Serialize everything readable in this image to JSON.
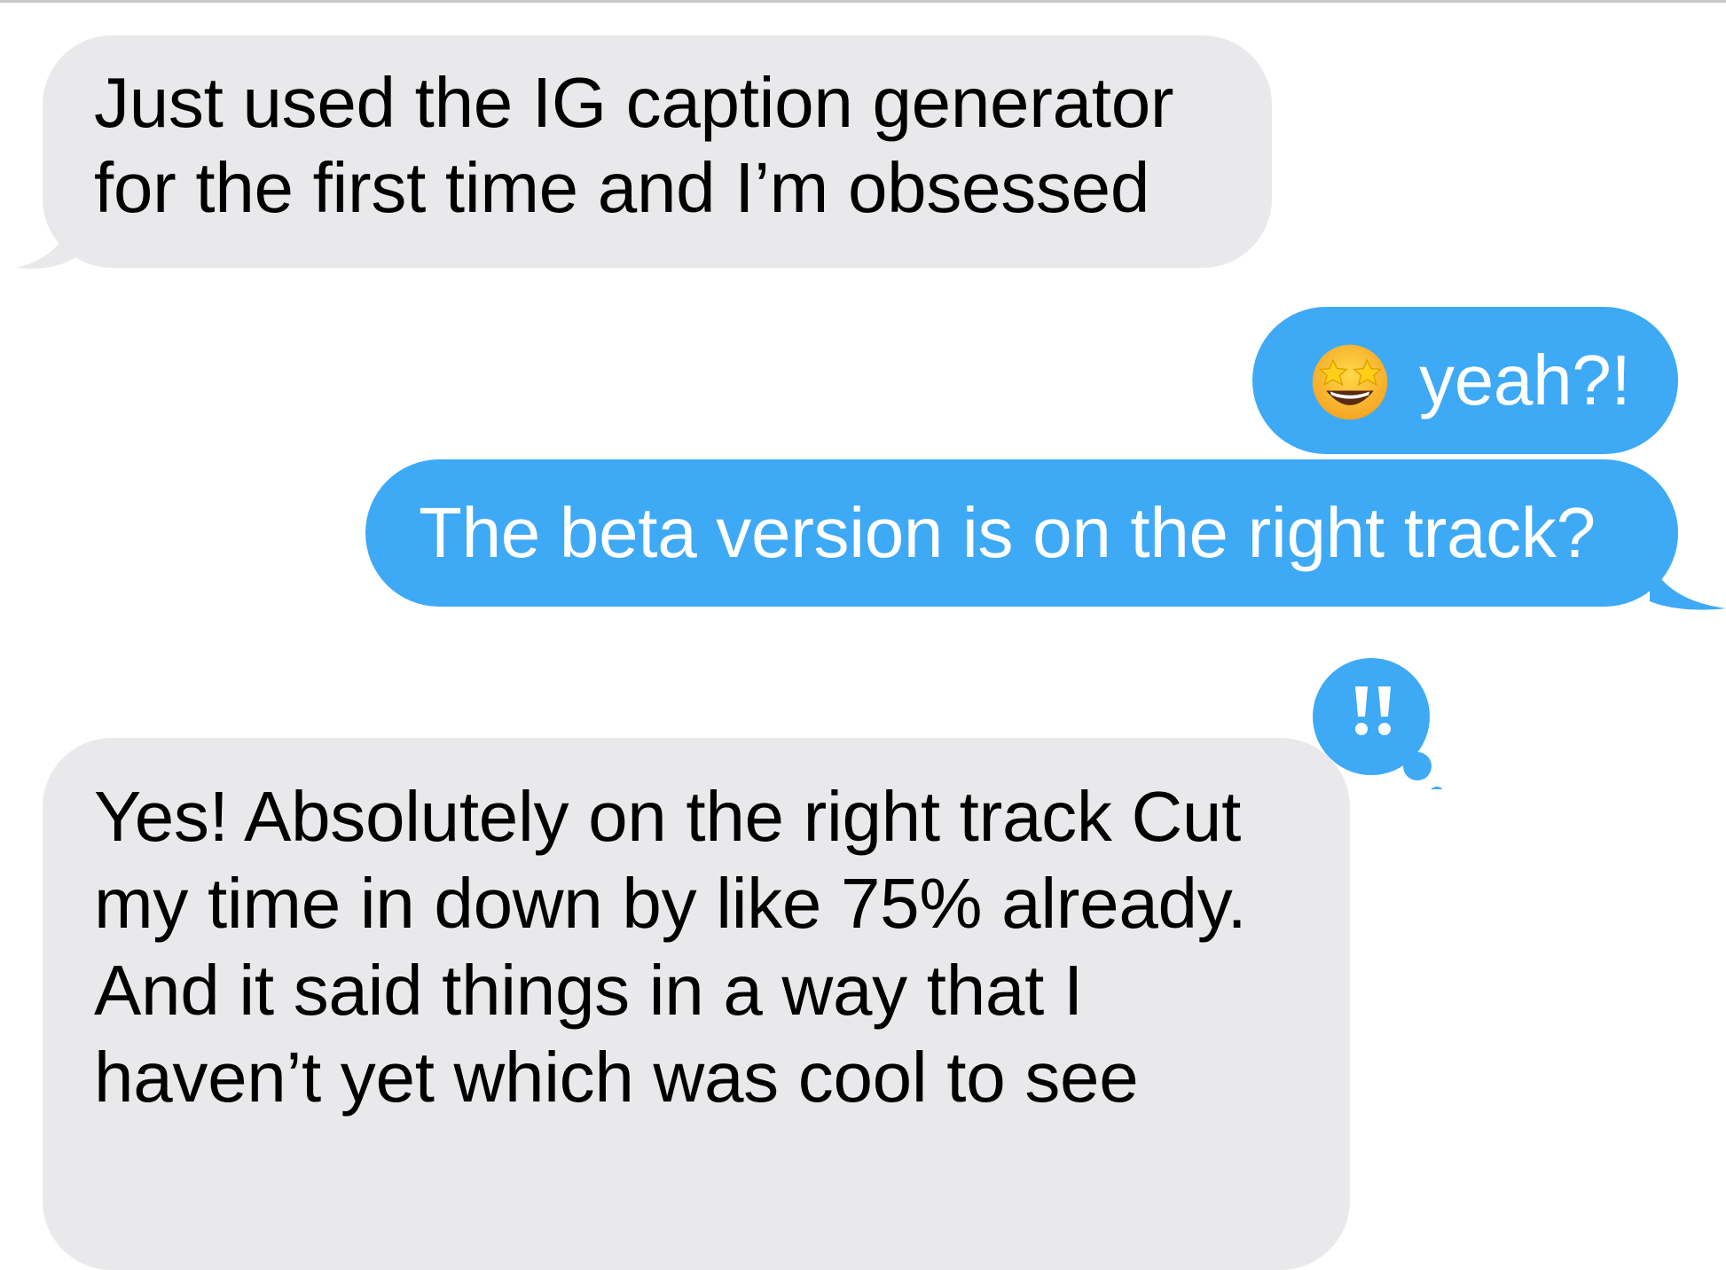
{
  "conversation": {
    "messages": [
      {
        "direction": "incoming",
        "lines": [
          "Just used the IG caption generator",
          "for the first time and I’m obsessed"
        ]
      },
      {
        "direction": "outgoing",
        "emoji": "star-struck-emoji",
        "text": "yeah?!"
      },
      {
        "direction": "outgoing",
        "text": "The beta version is on the right track?"
      },
      {
        "direction": "incoming",
        "lines": [
          "Yes! Absolutely on the right track Cut",
          "my time in down by like 75% already.",
          "And it said things in a way that I",
          "haven’t yet which was cool to see"
        ]
      }
    ],
    "tapback": {
      "icon": "double-exclamation-icon",
      "label": "‼"
    }
  },
  "colors": {
    "incoming_bubble": "#e9e9eb",
    "outgoing_bubble": "#3ea9f5",
    "background": "#ffffff"
  }
}
